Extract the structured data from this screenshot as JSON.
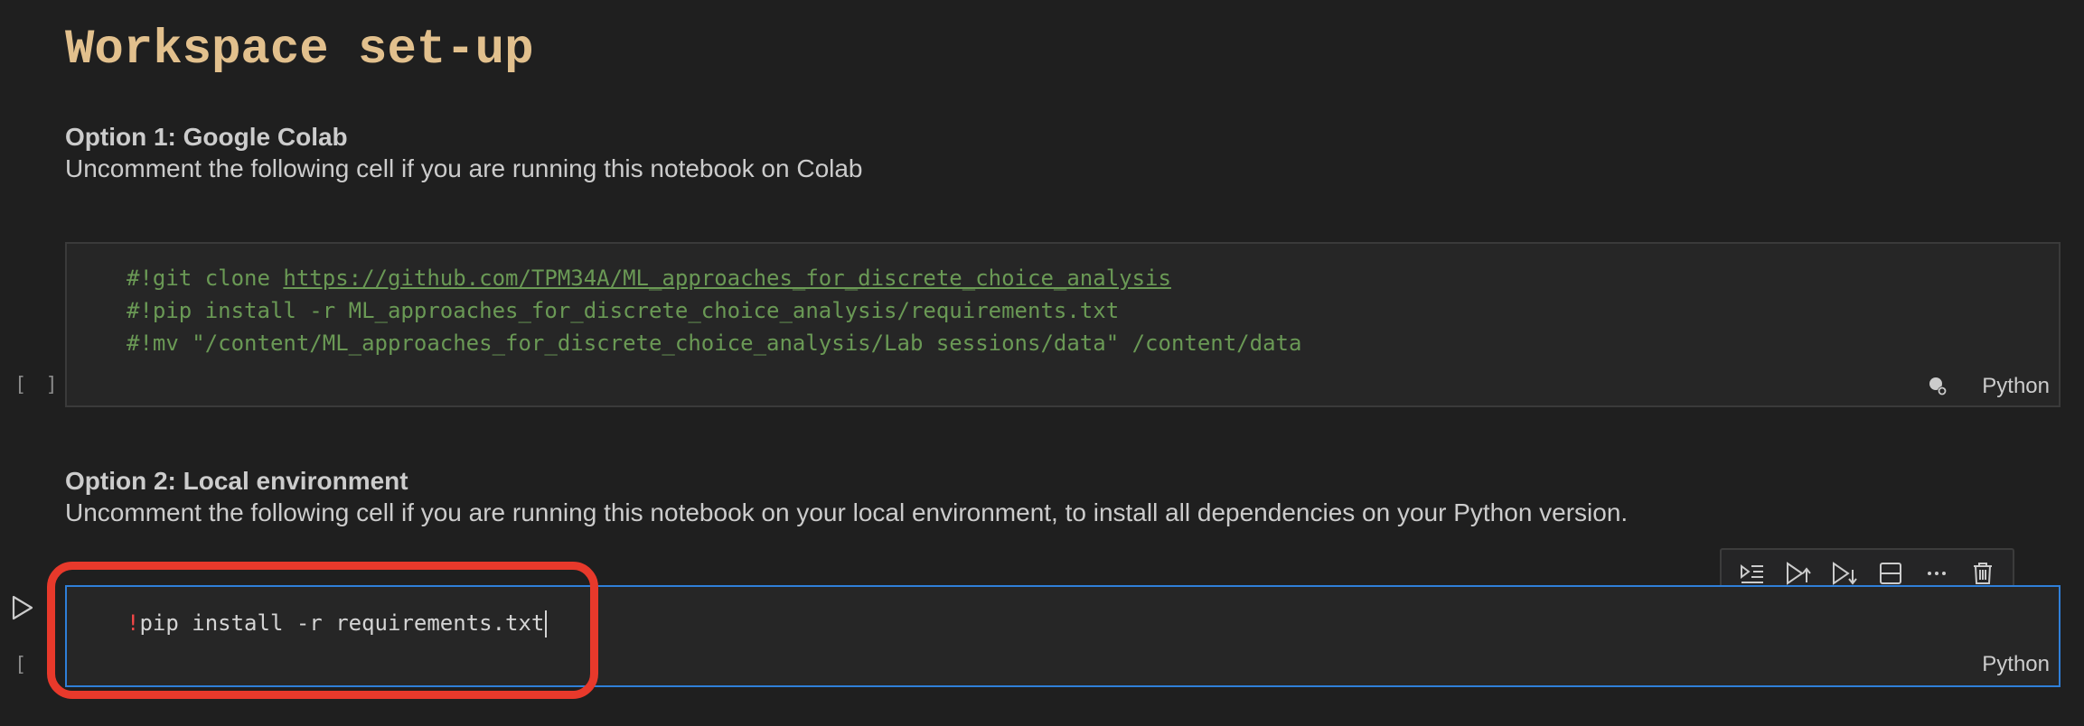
{
  "heading": "Workspace set-up",
  "option1": {
    "title": "Option 1: Google Colab",
    "desc": "Uncomment the following cell if you are running this notebook on Colab"
  },
  "cell1": {
    "line1_prefix": "#!git clone ",
    "line1_link": "https://github.com/TPM34A/ML_approaches_for_discrete_choice_analysis",
    "line2": "#!pip install -r ML_approaches_for_discrete_choice_analysis/requirements.txt",
    "line3": "#!mv \"/content/ML_approaches_for_discrete_choice_analysis/Lab sessions/data\" /content/data",
    "language": "Python",
    "exec_count": "[ ]"
  },
  "option2": {
    "title": "Option 2: Local environment",
    "desc": "Uncomment the following cell if you are running this notebook on your local environment, to install all dependencies on your Python version."
  },
  "cell2": {
    "bang": "!",
    "code": "pip install -r requirements.txt",
    "language": "Python",
    "exec_count": "[ ]"
  },
  "icons": {
    "kernel": "kernel-status-icon",
    "run": "run-cell-icon",
    "toolbar": [
      "run-by-line-icon",
      "execute-above-icon",
      "execute-below-icon",
      "split-cell-icon",
      "more-actions-icon",
      "delete-cell-icon"
    ]
  },
  "colors": {
    "background": "#1f1f1f",
    "heading": "#e2c08d",
    "comment": "#6a9955",
    "focus_border": "#2f7fd8",
    "highlight": "#e8392b"
  }
}
